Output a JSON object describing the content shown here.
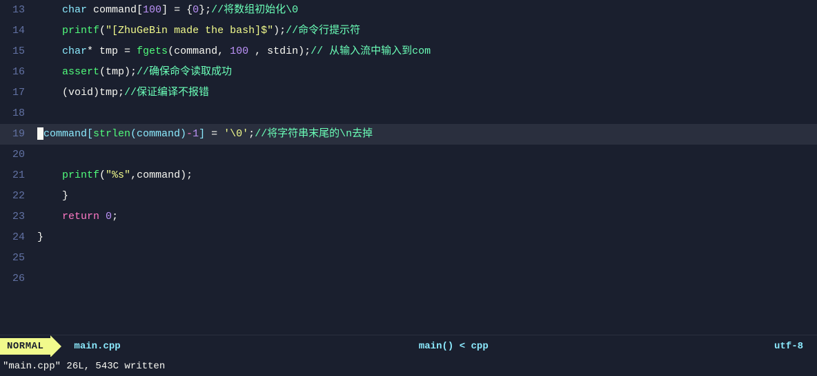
{
  "editor": {
    "background": "#1a1f2e",
    "lines": [
      {
        "number": "13",
        "highlighted": false,
        "content": [
          {
            "type": "indent",
            "text": "    "
          },
          {
            "type": "c-type",
            "text": "char"
          },
          {
            "type": "c-normal",
            "text": " command["
          },
          {
            "type": "c-number",
            "text": "100"
          },
          {
            "type": "c-normal",
            "text": "] = {"
          },
          {
            "type": "c-number",
            "text": "0"
          },
          {
            "type": "c-normal",
            "text": "};"
          },
          {
            "type": "c-comment",
            "text": "//将数组初始化\\0"
          }
        ]
      },
      {
        "number": "14",
        "highlighted": false,
        "content": [
          {
            "type": "indent",
            "text": "    "
          },
          {
            "type": "c-func",
            "text": "printf"
          },
          {
            "type": "c-normal",
            "text": "("
          },
          {
            "type": "c-string",
            "text": "\"[ZhuGeBin made the bash]$\""
          },
          {
            "type": "c-normal",
            "text": ");"
          },
          {
            "type": "c-comment",
            "text": "//命令行提示符"
          }
        ]
      },
      {
        "number": "15",
        "highlighted": false,
        "content": [
          {
            "type": "indent",
            "text": "    "
          },
          {
            "type": "c-type",
            "text": "char"
          },
          {
            "type": "c-normal",
            "text": "* tmp = "
          },
          {
            "type": "c-func",
            "text": "fgets"
          },
          {
            "type": "c-normal",
            "text": "(command, "
          },
          {
            "type": "c-number",
            "text": "100"
          },
          {
            "type": "c-normal",
            "text": " , stdin);"
          },
          {
            "type": "c-comment",
            "text": "// 从输入流中输入到com"
          }
        ]
      },
      {
        "number": "16",
        "highlighted": false,
        "content": [
          {
            "type": "indent",
            "text": "    "
          },
          {
            "type": "c-func",
            "text": "assert"
          },
          {
            "type": "c-normal",
            "text": "(tmp);"
          },
          {
            "type": "c-comment",
            "text": "//确保命令读取成功"
          }
        ]
      },
      {
        "number": "17",
        "highlighted": false,
        "content": [
          {
            "type": "indent",
            "text": "    "
          },
          {
            "type": "c-normal",
            "text": "(void)tmp;"
          },
          {
            "type": "c-comment",
            "text": "//保证编译不报错"
          }
        ]
      },
      {
        "number": "18",
        "highlighted": false,
        "content": []
      },
      {
        "number": "19",
        "highlighted": true,
        "content": [
          {
            "type": "cursor",
            "text": ""
          },
          {
            "type": "c-bracket",
            "text": "command["
          },
          {
            "type": "c-func",
            "text": "strlen"
          },
          {
            "type": "c-bracket",
            "text": "(command)"
          },
          {
            "type": "c-operator",
            "text": "-"
          },
          {
            "type": "c-number",
            "text": "1"
          },
          {
            "type": "c-bracket",
            "text": "]"
          },
          {
            "type": "c-normal",
            "text": " = "
          },
          {
            "type": "c-char",
            "text": "'\\0'"
          },
          {
            "type": "c-normal",
            "text": ";"
          },
          {
            "type": "c-comment",
            "text": "//将字符串末尾的\\n去掉"
          }
        ]
      },
      {
        "number": "20",
        "highlighted": false,
        "content": []
      },
      {
        "number": "21",
        "highlighted": false,
        "content": [
          {
            "type": "indent",
            "text": "    "
          },
          {
            "type": "c-func",
            "text": "printf"
          },
          {
            "type": "c-normal",
            "text": "("
          },
          {
            "type": "c-string",
            "text": "\"%s\""
          },
          {
            "type": "c-normal",
            "text": ",command);"
          }
        ]
      },
      {
        "number": "22",
        "highlighted": false,
        "content": [
          {
            "type": "indent",
            "text": "    "
          },
          {
            "type": "c-normal",
            "text": "}"
          }
        ]
      },
      {
        "number": "23",
        "highlighted": false,
        "content": [
          {
            "type": "indent",
            "text": "    "
          },
          {
            "type": "c-keyword",
            "text": "return"
          },
          {
            "type": "c-normal",
            "text": " "
          },
          {
            "type": "c-number",
            "text": "0"
          },
          {
            "type": "c-normal",
            "text": ";"
          }
        ]
      },
      {
        "number": "24",
        "highlighted": false,
        "content": [
          {
            "type": "c-normal",
            "text": "}"
          }
        ]
      },
      {
        "number": "25",
        "highlighted": false,
        "content": []
      },
      {
        "number": "26",
        "highlighted": false,
        "content": []
      }
    ]
  },
  "statusBar": {
    "mode": "NORMAL",
    "filename": "main.cpp",
    "func": "main()",
    "lt": "<",
    "filetype": "cpp",
    "encoding": "utf-8"
  },
  "statusMsg": {
    "text": "\"main.cpp\" 26L, 543C written"
  }
}
